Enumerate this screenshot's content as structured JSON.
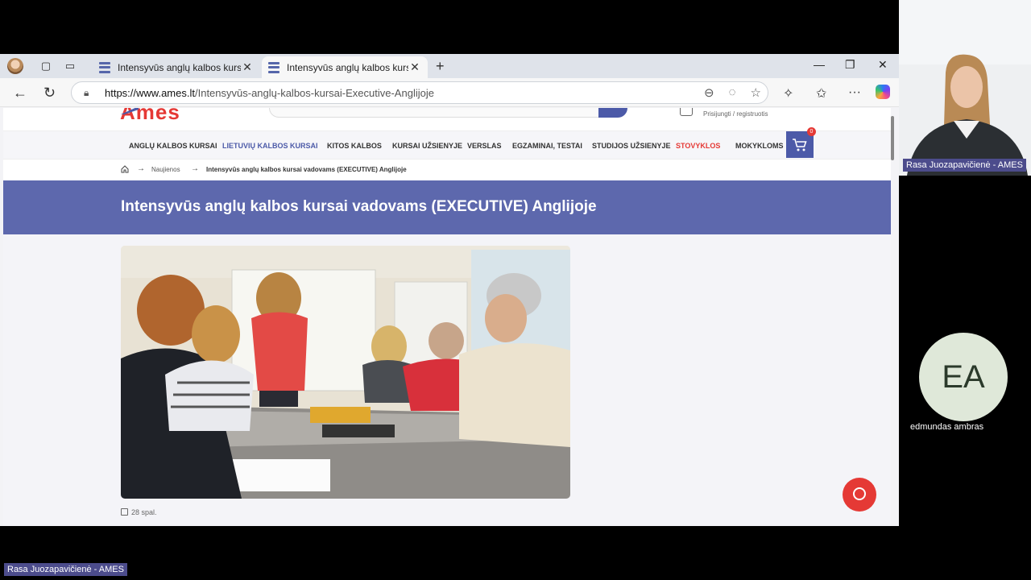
{
  "browser": {
    "tabs": [
      {
        "title": "Intensyvūs anglų kalbos kursai Ex"
      },
      {
        "title": "Intensyvūs anglų kalbos kursai Ex"
      }
    ],
    "url_host": "https://www.ames.lt",
    "url_path": "/Intensyvūs-anglų-kalbos-kursai-Executive-Anglijoje"
  },
  "site": {
    "logo": "Ames",
    "login": "Prisijungti / registruotis",
    "menu": [
      "ANGLŲ KALBOS KURSAI",
      "LIETUVIŲ KALBOS KURSAI",
      "KITOS KALBOS",
      "KURSAI UŽSIENYJE",
      "VERSLAS",
      "EGZAMINAI, TESTAI",
      "STUDIJOS UŽSIENYJE",
      "STOVYKLOS",
      "MOKYKLOMS"
    ],
    "cart_count": "0",
    "colors": {
      "brand_blue": "#5d68ad",
      "brand_red": "#e53935"
    }
  },
  "breadcrumb": {
    "link": "Naujienos",
    "current": "Intensyvūs anglų kalbos kursai vadovams (EXECUTIVE) Anglijoje"
  },
  "article": {
    "title": "Intensyvūs anglų kalbos kursai vadovams (EXECUTIVE) Anglijoje",
    "date": "28 spal."
  },
  "meeting": {
    "presenter": "Rasa Juozapavičienė - AMES",
    "participant_initials": "EA",
    "participant_name": "edmundas ambras",
    "bottom_label": "Rasa Juozapavičienė - AMES"
  }
}
